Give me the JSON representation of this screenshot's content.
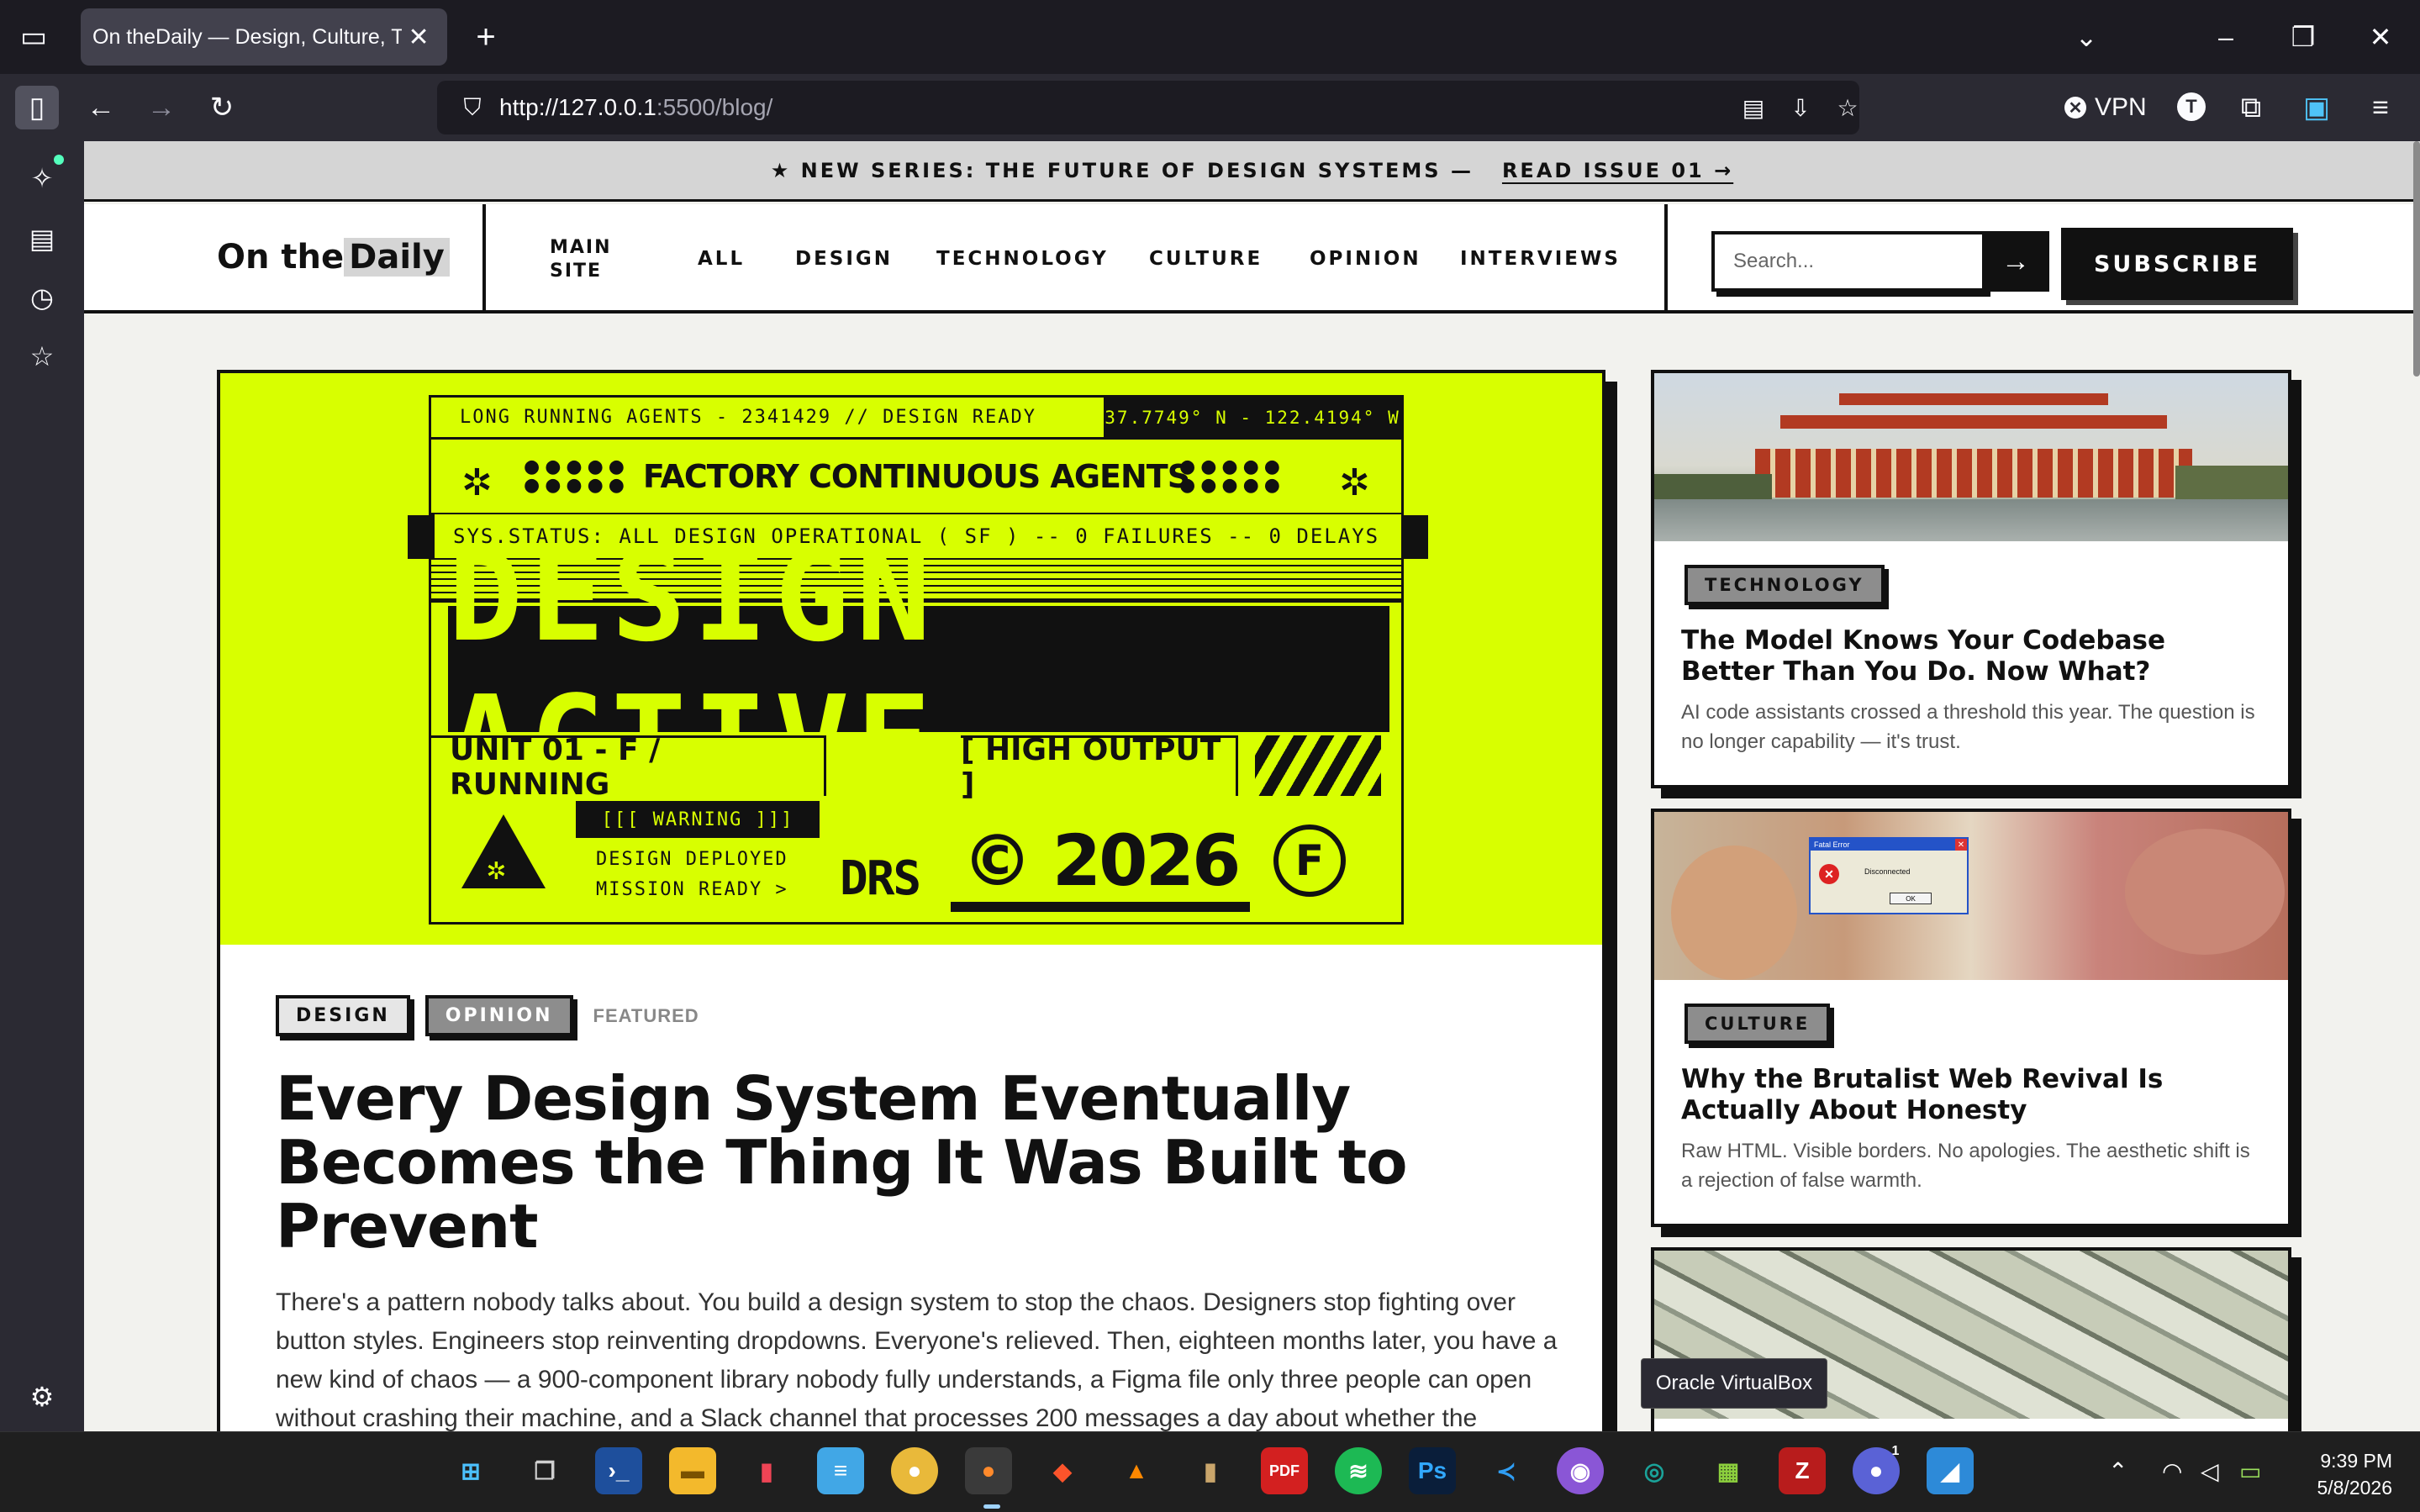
{
  "browser": {
    "tab_title": "On theDaily — Design, Culture, Tech",
    "url_host": "http://127.0.0.1",
    "url_rest": ":5500/blog/",
    "vpn_label": "VPN",
    "profile_initial": "T"
  },
  "banner": {
    "text": "★ NEW SERIES: THE FUTURE OF DESIGN SYSTEMS —",
    "cta": "READ ISSUE 01 →"
  },
  "header": {
    "logo_pre": "On the",
    "logo_hl": "Daily",
    "main_site_line1": "MAIN",
    "main_site_line2": "SITE",
    "nav": [
      "ALL",
      "DESIGN",
      "TECHNOLOGY",
      "CULTURE",
      "OPINION",
      "INTERVIEWS"
    ],
    "search_placeholder": "Search...",
    "search_button": "→",
    "subscribe": "SUBSCRIBE"
  },
  "poster": {
    "row1_left": "LONG RUNNING AGENTS - 2341429  // DESIGN READY",
    "row1_right": "37.7749° N - 122.4194° W",
    "title": "FACTORY CONTINUOUS AGENTS",
    "status": "SYS.STATUS: ALL DESIGN OPERATIONAL ( SF ) -- 0 FAILURES -- 0 DELAYS",
    "big": "DESIGN ACTIVE",
    "unit": "UNIT 01 - F / RUNNING",
    "output": "[ HIGH OUTPUT ]",
    "warning": "[[[ WARNING ]]]",
    "deployed_1": "DESIGN DEPLOYED",
    "deployed_2": "MISSION READY >",
    "drs": "DRS",
    "year": "© 2026",
    "f_mark": "F"
  },
  "hero": {
    "tags": [
      "DESIGN",
      "OPINION"
    ],
    "featured": "FEATURED",
    "title": "Every Design System Eventually Becomes the Thing It Was Built to Prevent",
    "excerpt": "There's a pattern nobody talks about. You build a design system to stop the chaos. Designers stop fighting over button styles. Engineers stop reinventing dropdowns. Everyone's relieved. Then, eighteen months later, you have a new kind of chaos — a 900-component library nobody fully understands, a Figma file only three people can open without crashing their machine, and a Slack channel that processes 200 messages a day about whether the"
  },
  "cards": [
    {
      "tag": "TECHNOLOGY",
      "title": "The Model Knows Your Codebase Better Than You Do. Now What?",
      "text": "AI code assistants crossed a threshold this year. The question is no longer capability — it's trust."
    },
    {
      "tag": "CULTURE",
      "title": "Why the Brutalist Web Revival Is Actually About Honesty",
      "text": "Raw HTML. Visible borders. No apologies. The aesthetic shift is a rejection of false warmth."
    },
    {
      "tag": "",
      "title": "",
      "text": ""
    }
  ],
  "dialog": {
    "title": "Fatal Error",
    "message": "Disconnected",
    "ok": "OK"
  },
  "tooltip": "Oracle VirtualBox",
  "taskbar": {
    "time": "9:39 PM",
    "date": "5/8/2026",
    "notification_count": "1"
  },
  "colors": {
    "accent_lime": "#d8ff00",
    "ink": "#111111",
    "tag_gray": "#8d8d8d"
  }
}
